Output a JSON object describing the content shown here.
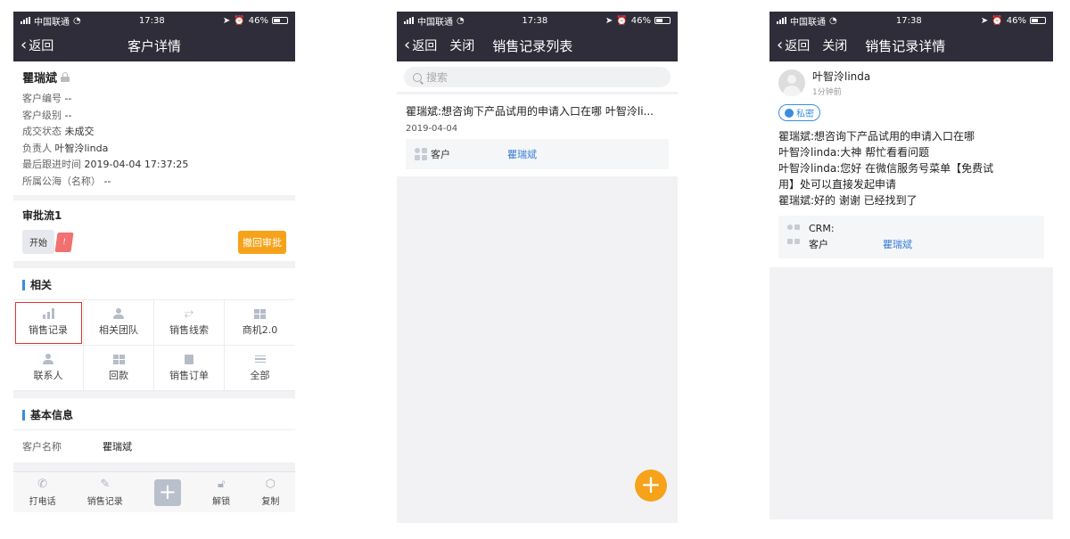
{
  "status": {
    "carrier": "中国联通",
    "time": "17:38",
    "battery": "46%"
  },
  "screen1": {
    "nav": {
      "back": "返回",
      "title": "客户详情"
    },
    "customer": {
      "name": "瞿瑞斌",
      "fields": [
        {
          "label": "客户编号",
          "value": "--"
        },
        {
          "label": "客户级别",
          "value": "--"
        },
        {
          "label": "成交状态",
          "value": "未成交"
        },
        {
          "label": "负责人",
          "value": "叶智泠linda"
        },
        {
          "label": "最后跟进时间",
          "value": "2019-04-04 17:37:25"
        },
        {
          "label": "所属公海（名称）",
          "value": "--"
        }
      ]
    },
    "approval": {
      "title": "审批流1",
      "step_start": "开始",
      "step_alert": "!",
      "revoke": "撤回审批"
    },
    "related": {
      "title": "相关",
      "items": [
        {
          "label": "销售记录",
          "icon": "bar-chart-icon"
        },
        {
          "label": "相关团队",
          "icon": "team-icon"
        },
        {
          "label": "销售线索",
          "icon": "lead-icon"
        },
        {
          "label": "商机2.0",
          "icon": "grid-icon"
        },
        {
          "label": "联系人",
          "icon": "contact-icon"
        },
        {
          "label": "回款",
          "icon": "payment-icon"
        },
        {
          "label": "销售订单",
          "icon": "order-icon"
        },
        {
          "label": "全部",
          "icon": "menu-icon"
        }
      ]
    },
    "basic": {
      "title": "基本信息",
      "name_label": "客户名称",
      "name_value": "瞿瑞斌"
    },
    "tabbar": {
      "call": "打电话",
      "record": "销售记录",
      "unlock": "解锁",
      "copy": "复制"
    }
  },
  "screen2": {
    "nav": {
      "back": "返回",
      "close": "关闭",
      "title": "销售记录列表"
    },
    "search_placeholder": "搜索",
    "record": {
      "title": "瞿瑞斌:想咨询下产品试用的申请入口在哪 叶智泠li...",
      "date": "2019-04-04",
      "rel_label": "客户",
      "rel_value": "瞿瑞斌"
    }
  },
  "screen3": {
    "nav": {
      "back": "返回",
      "close": "关闭",
      "title": "销售记录详情"
    },
    "author": "叶智泠linda",
    "time_ago": "1分钟前",
    "privacy": "私密",
    "lines": [
      "瞿瑞斌:想咨询下产品试用的申请入口在哪",
      "叶智泠linda:大神 帮忙看看问题",
      "叶智泠linda:您好 在微信服务号菜单【免费试",
      "用】处可以直接发起申请",
      "瞿瑞斌:好的 谢谢 已经找到了"
    ],
    "crm": {
      "label": "CRM:",
      "k": "客户",
      "v": "瞿瑞斌"
    }
  }
}
